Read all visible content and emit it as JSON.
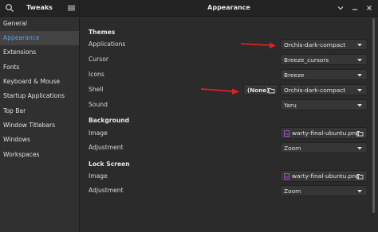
{
  "header": {
    "left_title": "Tweaks",
    "main_title": "Appearance"
  },
  "sidebar": {
    "items": [
      {
        "label": "General"
      },
      {
        "label": "Appearance"
      },
      {
        "label": "Extensions"
      },
      {
        "label": "Fonts"
      },
      {
        "label": "Keyboard & Mouse"
      },
      {
        "label": "Startup Applications"
      },
      {
        "label": "Top Bar"
      },
      {
        "label": "Window Titlebars"
      },
      {
        "label": "Windows"
      },
      {
        "label": "Workspaces"
      }
    ],
    "active_index": 1
  },
  "themes": {
    "heading": "Themes",
    "applications": {
      "label": "Applications",
      "value": "Orchis-dark-compact"
    },
    "cursor": {
      "label": "Cursor",
      "value": "Breeze_cursors"
    },
    "icons": {
      "label": "Icons",
      "value": "Breeze"
    },
    "shell": {
      "label": "Shell",
      "button": "(None)",
      "value": "Orchis-dark-compact"
    },
    "sound": {
      "label": "Sound",
      "value": "Yaru"
    }
  },
  "background": {
    "heading": "Background",
    "image": {
      "label": "Image",
      "value": "warty-final-ubuntu.png"
    },
    "adjustment": {
      "label": "Adjustment",
      "value": "Zoom"
    }
  },
  "lock_screen": {
    "heading": "Lock Screen",
    "image": {
      "label": "Image",
      "value": "warty-final-ubuntu.png"
    },
    "adjustment": {
      "label": "Adjustment",
      "value": "Zoom"
    }
  },
  "colors": {
    "accent": "#5f9df0",
    "annotation_arrow": "#e02020",
    "file_icon": "#a64ed6"
  }
}
